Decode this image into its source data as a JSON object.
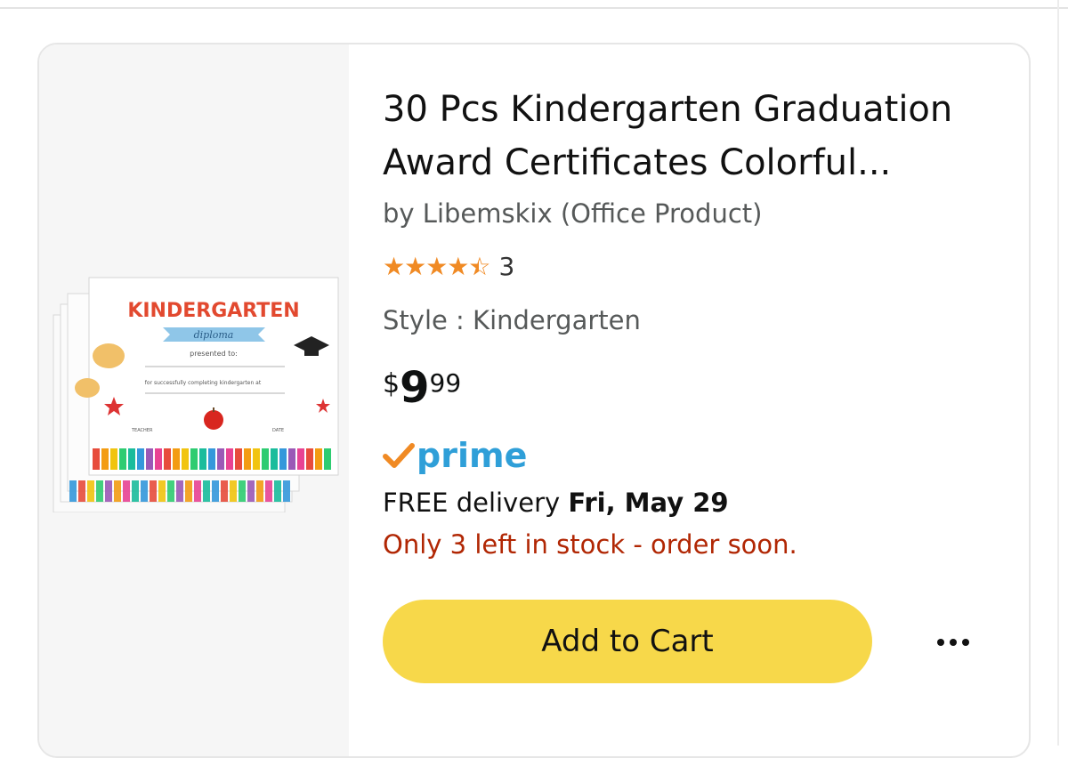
{
  "product": {
    "title_line1": "30 Pcs Kindergarten Graduation",
    "title_line2": "Award Certificates Colorful...",
    "byline": "by Libemskix (Office Product)",
    "rating_stars": 4.5,
    "rating_count": "3",
    "style": "Style : Kindergarten",
    "price_symbol": "$",
    "price_whole": "9",
    "price_fraction": "99",
    "prime_label": "prime",
    "delivery_prefix": "FREE delivery ",
    "delivery_date": "Fri, May 29",
    "stock_message": "Only 3 left in stock - order soon.",
    "add_to_cart_label": "Add to Cart"
  },
  "image": {
    "heading": "KINDERGARTEN",
    "subheading": "diploma",
    "presented": "presented to:",
    "completing": "for successfully completing kindergarten at",
    "teacher": "TEACHER",
    "date": "DATE"
  },
  "colors": {
    "star": "#f08a24",
    "prime_blue": "#2f9fd8",
    "prime_check": "#f08a24",
    "stock_red": "#b12704",
    "cart_yellow": "#f7d84a"
  },
  "icons": {
    "more": "ellipsis-horizontal-icon",
    "prime_check": "check-icon",
    "stars": "star-icon"
  }
}
